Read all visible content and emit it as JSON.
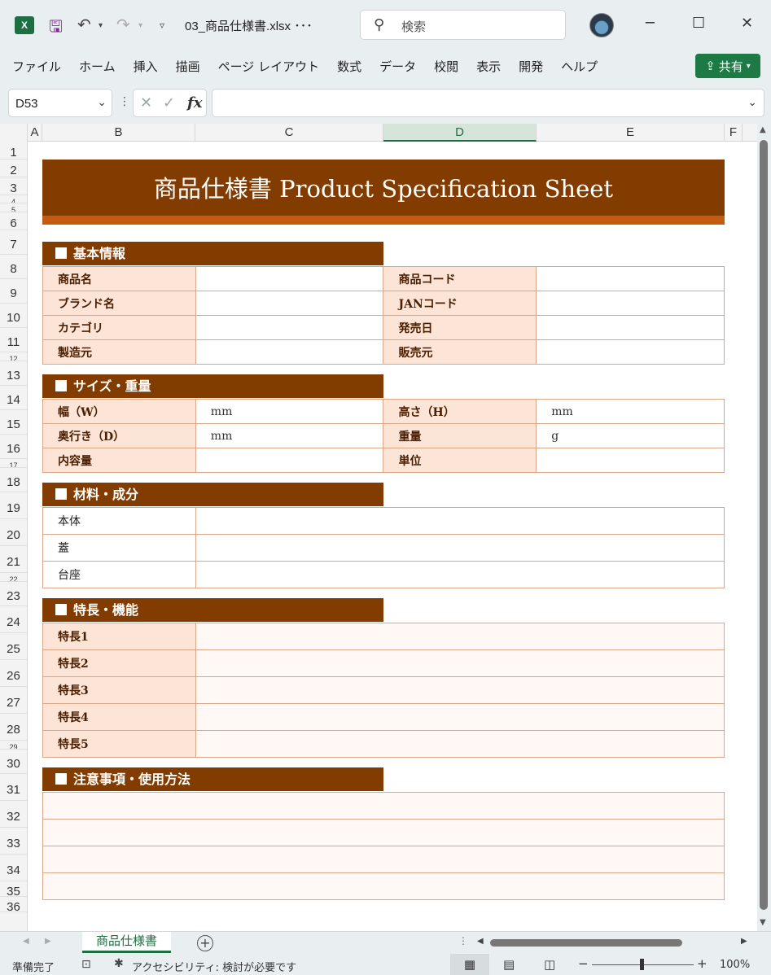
{
  "titlebar": {
    "file_title": "03_商品仕様書.xlsx ･･･",
    "search_label": "検索"
  },
  "ribbon": {
    "tabs": [
      "ファイル",
      "ホーム",
      "挿入",
      "描画",
      "ページ レイアウト",
      "数式",
      "データ",
      "校閲",
      "表示",
      "開発",
      "ヘルプ"
    ],
    "share_label": "共有"
  },
  "formula_bar": {
    "name_box": "D53",
    "formula": ""
  },
  "columns": [
    "A",
    "B",
    "C",
    "D",
    "E",
    "F"
  ],
  "rows": [
    "1",
    "2",
    "3",
    "4",
    "5",
    "6",
    "7",
    "8",
    "9",
    "10",
    "11",
    "12",
    "13",
    "14",
    "15",
    "16",
    "17",
    "18",
    "19",
    "20",
    "21",
    "22",
    "23",
    "24",
    "25",
    "26",
    "27",
    "28",
    "29",
    "30",
    "31",
    "32",
    "33",
    "34",
    "35",
    "36"
  ],
  "sheet": {
    "title": "商品仕様書  Product Specification Sheet",
    "basic": {
      "heading": "基本情報",
      "rows": [
        [
          "商品名",
          "",
          "商品コード",
          ""
        ],
        [
          "ブランド名",
          "",
          "JANコード",
          ""
        ],
        [
          "カテゴリ",
          "",
          "発売日",
          ""
        ],
        [
          "製造元",
          "",
          "販売元",
          ""
        ]
      ]
    },
    "size": {
      "heading": "サイズ・重量",
      "rows": [
        [
          "幅（W）",
          "mm",
          "高さ（H）",
          "mm"
        ],
        [
          "奥行き（D）",
          "mm",
          "重量",
          "g"
        ],
        [
          "内容量",
          "",
          "単位",
          ""
        ]
      ]
    },
    "material": {
      "heading": "材料・成分",
      "rows": [
        "本体",
        "蓋",
        "台座"
      ]
    },
    "features": {
      "heading": "特長・機能",
      "rows": [
        "特長1",
        "特長2",
        "特長3",
        "特長4",
        "特長5"
      ]
    },
    "notes": {
      "heading": "注意事項・使用方法"
    }
  },
  "sheet_tab": "商品仕様書",
  "status": {
    "ready": "準備完了",
    "accessibility": "アクセシビリティ: 検討が必要です",
    "zoom": "100%"
  },
  "colors": {
    "brand": "#1d6f42",
    "header_brown": "#833c00",
    "accent_orange": "#c55a11",
    "label_fill": "#fce4d6"
  }
}
